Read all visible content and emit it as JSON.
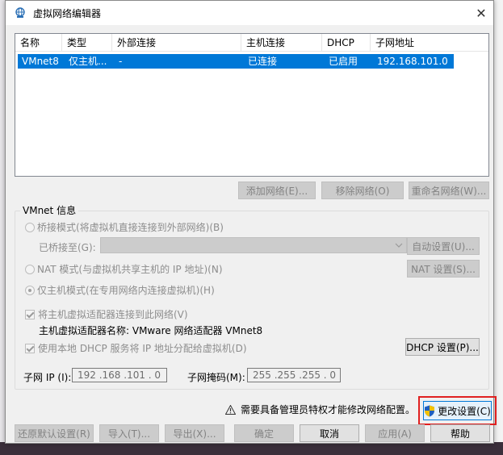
{
  "window": {
    "title": "虚拟网络编辑器",
    "close_glyph": "✕"
  },
  "table": {
    "headers": [
      "名称",
      "类型",
      "外部连接",
      "主机连接",
      "DHCP",
      "子网地址"
    ],
    "rows": [
      [
        "VMnet8",
        "仅主机...",
        "-",
        "已连接",
        "已启用",
        "192.168.101.0"
      ]
    ]
  },
  "table_buttons": {
    "add": "添加网络(E)...",
    "remove": "移除网络(O)",
    "rename": "重命名网络(W)..."
  },
  "vmnet_info": {
    "group_label": "VMnet 信息",
    "bridge_mode": "桥接模式(将虚拟机直接连接到外部网络)(B)",
    "bridged_to_label": "已桥接至(G):",
    "auto_settings": "自动设置(U)...",
    "nat_mode": "NAT 模式(与虚拟机共享主机的 IP 地址)(N)",
    "nat_settings": "NAT 设置(S)...",
    "host_only_mode": "仅主机模式(在专用网络内连接虚拟机)(H)",
    "connect_adapter": "将主机虚拟适配器连接到此网络(V)",
    "adapter_name": "主机虚拟适配器名称: VMware 网络适配器 VMnet8",
    "use_dhcp": "使用本地 DHCP 服务将 IP 地址分配给虚拟机(D)",
    "dhcp_settings": "DHCP 设置(P)...",
    "subnet_ip_label": "子网 IP (I):",
    "subnet_ip_value": "192 .168 .101 . 0",
    "subnet_mask_label": "子网掩码(M):",
    "subnet_mask_value": "255 .255 .255 . 0"
  },
  "admin_notice": "需要具备管理员特权才能修改网络配置。",
  "change_settings": "更改设置(C)",
  "footer": {
    "restore_defaults": "还原默认设置(R)",
    "import": "导入(T)...",
    "export": "导出(X)...",
    "ok": "确定",
    "cancel": "取消",
    "apply": "应用(A)",
    "help": "帮助"
  },
  "colors": {
    "selection": "#0078d7",
    "highlight_box": "#e02020",
    "shield_blue": "#1f5fbf",
    "shield_yellow": "#f2c200"
  }
}
